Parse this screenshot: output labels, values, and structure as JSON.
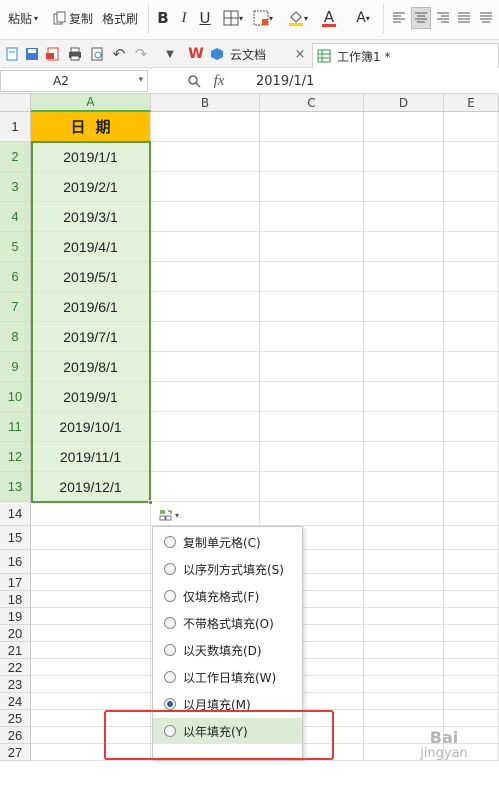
{
  "ribbon": {
    "paste_label": "粘贴",
    "copy_label": "复制",
    "format_painter_label": "格式刷",
    "bold": "B",
    "italic": "I",
    "underline": "U",
    "font_color_letter": "A",
    "fill_letter": "A"
  },
  "tabs": {
    "docs_label": "云文档",
    "workbook_label": "工作簿1 *",
    "close_glyph": "×"
  },
  "formula_bar": {
    "name_box": "A2",
    "fx": "fx",
    "formula": "2019/1/1"
  },
  "columns": [
    "A",
    "B",
    "C",
    "D",
    "E"
  ],
  "rows": [
    "1",
    "2",
    "3",
    "4",
    "5",
    "6",
    "7",
    "8",
    "9",
    "10",
    "11",
    "12",
    "13",
    "14",
    "15",
    "16",
    "17",
    "18",
    "19",
    "20",
    "21",
    "22",
    "23",
    "24",
    "25",
    "26",
    "27"
  ],
  "column_a": {
    "header": "日期",
    "dates": [
      "2019/1/1",
      "2019/2/1",
      "2019/3/1",
      "2019/4/1",
      "2019/5/1",
      "2019/6/1",
      "2019/7/1",
      "2019/8/1",
      "2019/9/1",
      "2019/10/1",
      "2019/11/1",
      "2019/12/1"
    ]
  },
  "autofill_menu": {
    "items": [
      {
        "label": "复制单元格(C)",
        "selected": false
      },
      {
        "label": "以序列方式填充(S)",
        "selected": false
      },
      {
        "label": "仅填充格式(F)",
        "selected": false
      },
      {
        "label": "不带格式填充(O)",
        "selected": false
      },
      {
        "label": "以天数填充(D)",
        "selected": false
      },
      {
        "label": "以工作日填充(W)",
        "selected": false
      },
      {
        "label": "以月填充(M)",
        "selected": true
      },
      {
        "label": "以年填充(Y)",
        "selected": false
      }
    ]
  },
  "watermark": {
    "line1": "Bai",
    "line2": "jingyan"
  },
  "colors": {
    "header_fill": "#ffc000",
    "date_fill": "#e2f1da",
    "selection_border": "#5a9a3a",
    "highlight_box": "#e53935"
  }
}
